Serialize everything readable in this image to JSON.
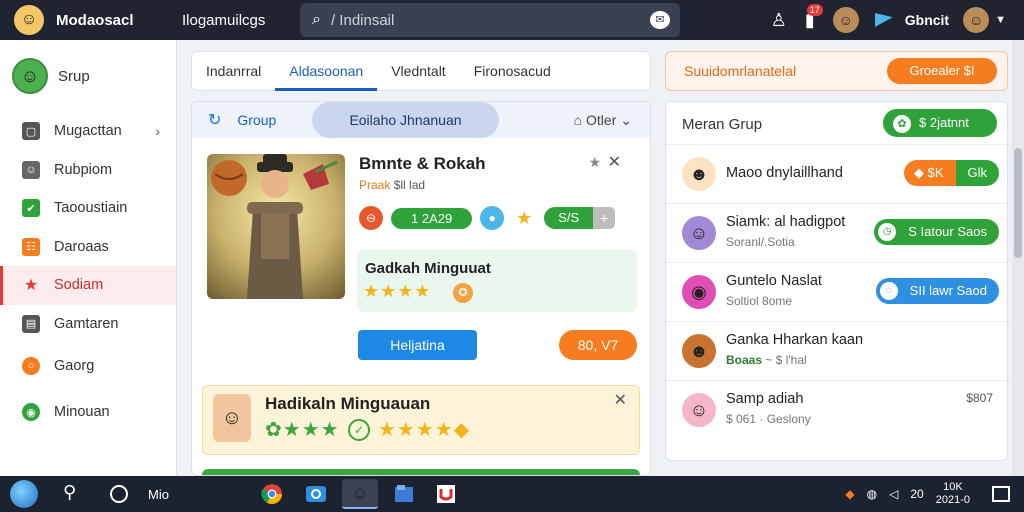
{
  "topbar": {
    "app_name": "Modaosacl",
    "section": "Ilogamuilcgs",
    "search_value": "/ Indinsail",
    "user_name": "Gbncit",
    "notif_count": "17"
  },
  "sidebar": {
    "head_label": "Srup",
    "items": [
      {
        "label": "Mugacttan",
        "color": "#555555",
        "glyph": "▢"
      },
      {
        "label": "Rubpiom",
        "color": "#666666",
        "glyph": "☺"
      },
      {
        "label": "Taooustiain",
        "color": "#2fa33a",
        "glyph": "✔"
      },
      {
        "label": "Daroaas",
        "color": "#f57c1f",
        "glyph": "☷"
      },
      {
        "label": "Sodiam",
        "color": "#e53935",
        "glyph": "★"
      },
      {
        "label": "Gamtaren",
        "color": "#555555",
        "glyph": "▤"
      },
      {
        "label": "Gaorg",
        "color": "#f57c1f",
        "glyph": "○"
      },
      {
        "label": "Minouan",
        "color": "#2fa33a",
        "glyph": "◉"
      }
    ]
  },
  "tabs": [
    "Indanrral",
    "Aldasoonan",
    "Vledntalt",
    "Fironosacud"
  ],
  "center": {
    "header_group": "Group",
    "header_pill": "Eoilaho Jhnanuan",
    "header_filter": "Otler",
    "card": {
      "title": "Bmnte & Rokah",
      "sub_accent": "Praak",
      "sub_rest": " $ll lad",
      "pill1": "1  2A29",
      "pill2": "S/S",
      "box_title": "Gadkah Minguuat"
    },
    "btn_blue": "Heljatina",
    "btn_orange": "80, V7",
    "promo_title": "Hadikaln Minguauan"
  },
  "right": {
    "banner_text": "Suuidomrlanatelal",
    "banner_button": "Groealer $I",
    "panel_title": "Meran Grup",
    "panel_button": "$ 2jatnnt",
    "rows": [
      {
        "name": "Maoo dnylaillhand",
        "sub": "",
        "sub_accent": "",
        "btn_left": "$K",
        "btn_right": "Glk",
        "right_text": ""
      },
      {
        "name": "Siamk: al hadigpot",
        "sub": "Soranl/.Sotia",
        "sub_accent": "",
        "btn": "S Iatour Saos",
        "right_text": ""
      },
      {
        "name": "Guntelo Naslat",
        "sub": "Soltiol 8ome",
        "sub_accent": "",
        "btn": "SII lawr Saod",
        "right_text": ""
      },
      {
        "name": "Ganka Hharkan kaan",
        "sub": " ~ $ l'hal",
        "sub_accent": "Boaas",
        "btn": "",
        "right_text": ""
      },
      {
        "name": "Samp adiah",
        "sub": "$ 061 · Geslony",
        "sub_accent": "",
        "btn": "",
        "right_text": "$807"
      }
    ]
  },
  "taskbar": {
    "label": "Mio",
    "clock_time": "10K",
    "clock_date": "2021-0",
    "tray_num": "20"
  },
  "colors": {
    "accent_blue": "#1a5fc0",
    "green": "#2fa33a",
    "orange": "#f57c1f",
    "red_active": "#e53935"
  }
}
